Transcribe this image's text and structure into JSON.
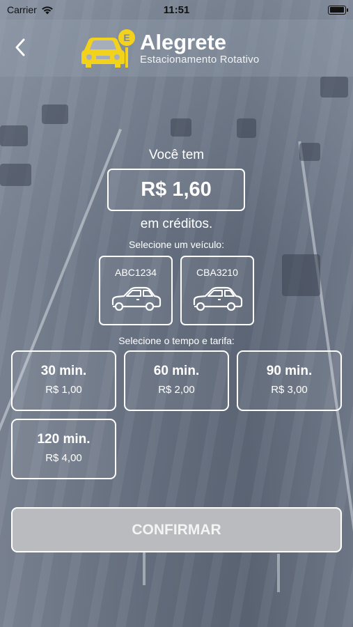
{
  "status_bar": {
    "carrier": "Carrier",
    "time": "11:51"
  },
  "header": {
    "brand_name": "Alegrete",
    "brand_subtitle": "Estacionamento Rotativo",
    "logo_badge_letter": "E",
    "logo_color": "#f2d21b"
  },
  "credit": {
    "prefix": "Você tem",
    "amount": "R$ 1,60",
    "suffix": "em créditos."
  },
  "vehicles": {
    "label": "Selecione um veículo:",
    "items": [
      {
        "plate": "ABC1234",
        "icon": "car-icon"
      },
      {
        "plate": "CBA3210",
        "icon": "car-icon"
      }
    ]
  },
  "tariffs": {
    "label": "Selecione o tempo e tarifa:",
    "items": [
      {
        "time": "30 min.",
        "price": "R$ 1,00"
      },
      {
        "time": "60 min.",
        "price": "R$ 2,00"
      },
      {
        "time": "90 min.",
        "price": "R$ 3,00"
      },
      {
        "time": "120 min.",
        "price": "R$ 4,00"
      }
    ]
  },
  "confirm_label": "CONFIRMAR",
  "colors": {
    "confirm_disabled": "#b9bbbe",
    "text": "#ffffff"
  }
}
